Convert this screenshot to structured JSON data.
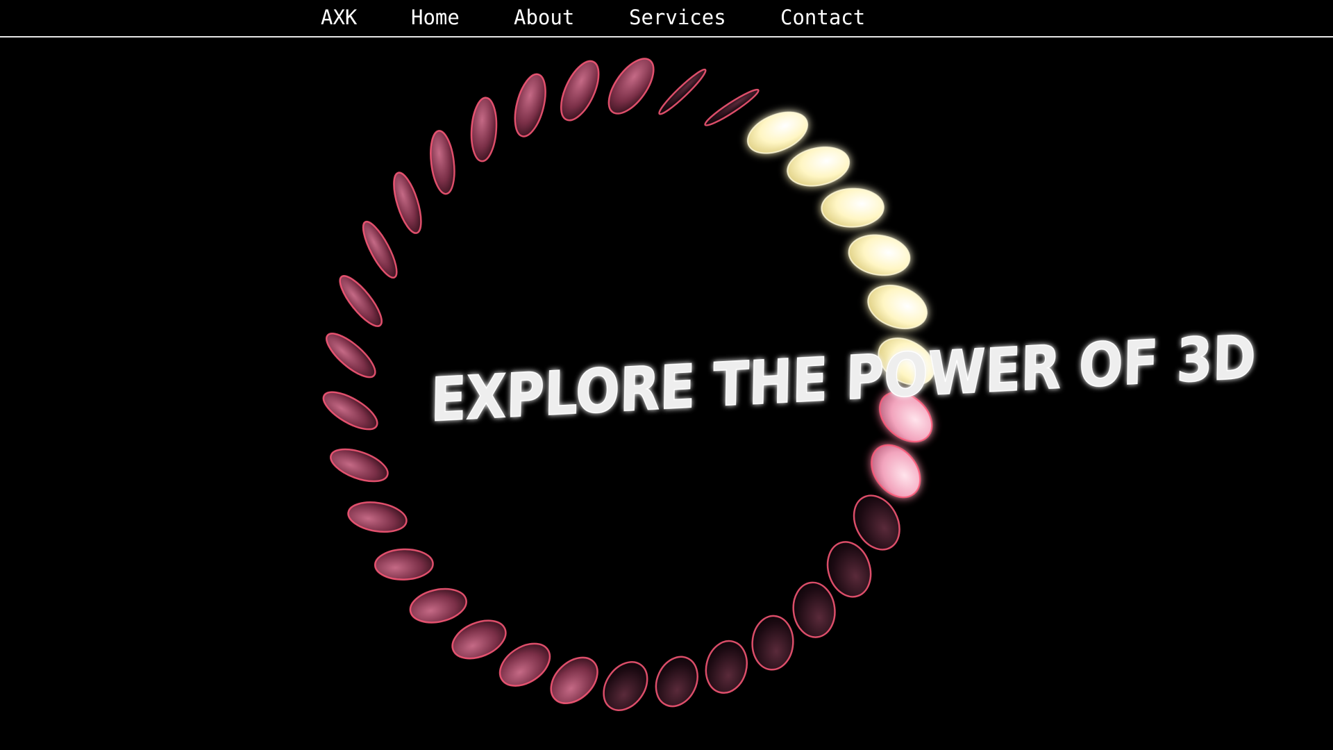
{
  "nav": {
    "brand": "AXK",
    "links": [
      "Home",
      "About",
      "Services",
      "Contact"
    ]
  },
  "hero": {
    "headline": "EXPLORE THE POWER OF 3D"
  },
  "colors": {
    "background": "#000000",
    "nav_text": "#ffffff",
    "nav_divider": "#e8e8e8",
    "headline": "#eeeeee",
    "petal_warm": "#b0506c",
    "petal_glow": "#fff3b0",
    "petal_edge": "#ff5a7a"
  }
}
